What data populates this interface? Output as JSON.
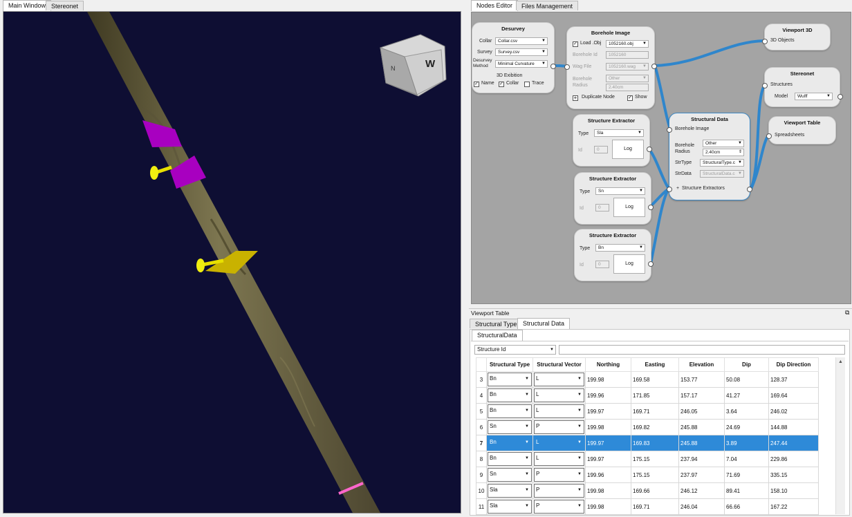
{
  "left_tabs": [
    "Main Window",
    "Stereonet"
  ],
  "viewcube_label": "W",
  "viewcube_side": "N",
  "right_tabs": [
    "Nodes Editor",
    "Files Management"
  ],
  "nodes": {
    "desurvey": {
      "title": "Desurvey",
      "collar_label": "Collar",
      "collar_value": "Collar.csv",
      "survey_label": "Survey",
      "survey_value": "Survey.csv",
      "method_label": "Desurvey Method",
      "method_value": "Minimal Curvature",
      "exhibition_label": "3D Exibition",
      "name_label": "Name",
      "collar_check_label": "Collar",
      "trace_label": "Trace"
    },
    "borehole_image": {
      "title": "Borehole Image",
      "load_label": "Load .Obj",
      "obj_value": "1052160.obj",
      "borehole_id_label": "Borehole Id",
      "borehole_id_value": "1052160",
      "wag_label": "Wag File",
      "wag_value": "1052160.wag",
      "radius_label": "Borehole Radius",
      "radius_type": "Other",
      "radius_value": "2.40cm",
      "duplicate_label": "Duplicate Node",
      "show_label": "Show"
    },
    "viewport3d": {
      "title": "Viewport 3D",
      "input": "3D Objects"
    },
    "stereonet": {
      "title": "Stereonet",
      "input": "Structures",
      "model_label": "Model",
      "model_value": "Wulff"
    },
    "viewport_table": {
      "title": "Viewport Table",
      "input": "Spreadsheets"
    },
    "structural_data": {
      "title": "Structural Data",
      "image_label": "Borehole Image",
      "radius_label": "Borehole Radius",
      "radius_type": "Other",
      "radius_value": "2.40cm",
      "strtype_label": "StrType",
      "strtype_value": "StructuralType.c",
      "strdata_label": "StrData",
      "strdata_value": "StructuralData.c",
      "extractors_label": "Structure Extractors"
    },
    "extractors": [
      {
        "title": "Structure Extractor",
        "type_label": "Type",
        "type_value": "Sla",
        "id_label": "Id",
        "id_value": "0",
        "log_label": "Log"
      },
      {
        "title": "Structure Extractor",
        "type_label": "Type",
        "type_value": "Sn",
        "id_label": "Id",
        "id_value": "0",
        "log_label": "Log"
      },
      {
        "title": "Structure Extractor",
        "type_label": "Type",
        "type_value": "Bn",
        "id_label": "Id",
        "id_value": "0",
        "log_label": "Log"
      }
    ]
  },
  "viewport_table_panel": {
    "title": "Viewport Table",
    "tabs": [
      "Structural Type",
      "Structural Data"
    ],
    "sub_tab": "StructuralData",
    "filter_column": "Structure Id",
    "filter_value": ""
  },
  "table": {
    "headers": [
      "Structural Type",
      "Structural Vector",
      "Northing",
      "Easting",
      "Elevation",
      "Dip",
      "Dip Direction"
    ],
    "rows": [
      {
        "n": "3",
        "type": "Bn",
        "vector": "L",
        "northing": "199.98",
        "easting": "169.58",
        "elevation": "153.77",
        "dip": "50.08",
        "dipdir": "128.37"
      },
      {
        "n": "4",
        "type": "Bn",
        "vector": "L",
        "northing": "199.96",
        "easting": "171.85",
        "elevation": "157.17",
        "dip": "41.27",
        "dipdir": "169.64"
      },
      {
        "n": "5",
        "type": "Bn",
        "vector": "L",
        "northing": "199.97",
        "easting": "169.71",
        "elevation": "246.05",
        "dip": "3.64",
        "dipdir": "246.02"
      },
      {
        "n": "6",
        "type": "Sn",
        "vector": "P",
        "northing": "199.98",
        "easting": "169.82",
        "elevation": "245.88",
        "dip": "24.69",
        "dipdir": "144.88"
      },
      {
        "n": "7",
        "type": "Bn",
        "vector": "L",
        "northing": "199.97",
        "easting": "169.83",
        "elevation": "245.88",
        "dip": "3.89",
        "dipdir": "247.44"
      },
      {
        "n": "8",
        "type": "Bn",
        "vector": "L",
        "northing": "199.97",
        "easting": "175.15",
        "elevation": "237.94",
        "dip": "7.04",
        "dipdir": "229.86"
      },
      {
        "n": "9",
        "type": "Sn",
        "vector": "P",
        "northing": "199.96",
        "easting": "175.15",
        "elevation": "237.97",
        "dip": "71.69",
        "dipdir": "335.15"
      },
      {
        "n": "10",
        "type": "Sla",
        "vector": "P",
        "northing": "199.98",
        "easting": "169.66",
        "elevation": "246.12",
        "dip": "89.41",
        "dipdir": "158.10"
      },
      {
        "n": "11",
        "type": "Sla",
        "vector": "P",
        "northing": "199.98",
        "easting": "169.71",
        "elevation": "246.04",
        "dip": "66.66",
        "dipdir": "167.22"
      }
    ],
    "selected_row": "7"
  },
  "colors": {
    "selection": "#2e8ad8",
    "link": "#2f86cc",
    "viewport_bg": "#0e0e33",
    "plane_magenta": "#b000c8",
    "plane_yellow": "#d4c400"
  }
}
